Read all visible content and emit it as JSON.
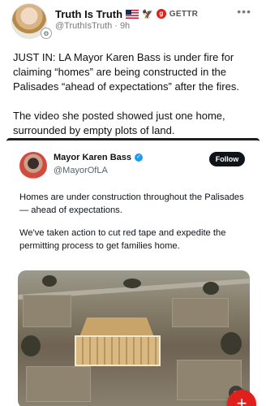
{
  "post": {
    "display_name": "Truth Is Truth",
    "flag_icon": "us-flag-icon",
    "eagle_icon": "eagle-icon",
    "gettr_icon": "gettr-logo-icon",
    "gettr_label": "GETTR",
    "handle": "@TruthIsTruth",
    "separator": "·",
    "time": "9h",
    "paragraphs": [
      "JUST IN: LA Mayor Karen Bass is under fire for claiming “homes” are being constructed in the Palisades “ahead of expectations” after the fires.",
      "The video she posted showed just one home, surrounded by empty plots of land."
    ]
  },
  "embed": {
    "name": "Mayor Karen Bass",
    "handle": "@MayorOfLA",
    "follow_label": "Follow",
    "paragraphs": [
      "Homes are under construction throughout the Palisades — ahead of expectations.",
      "We've taken action to cut red tape and expedite the permitting process to get families home."
    ]
  },
  "colors": {
    "accent": "#e0201a",
    "verified": "#1d9bf0",
    "follow_bg": "#0f1419"
  }
}
